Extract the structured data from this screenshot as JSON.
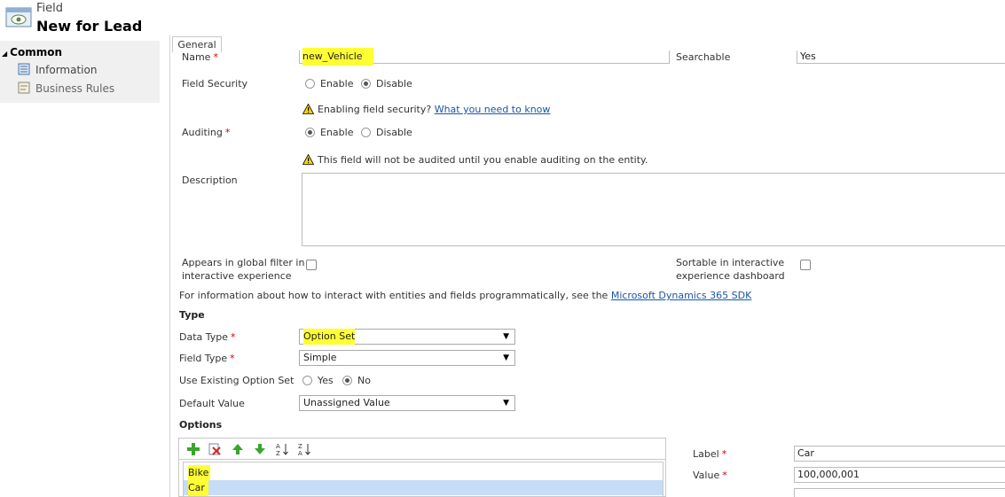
{
  "header": {
    "entity_label": "Field",
    "title": "New for Lead"
  },
  "sidebar": {
    "section": "Common",
    "items": [
      {
        "label": "Information",
        "icon": "information-icon"
      },
      {
        "label": "Business Rules",
        "icon": "business-rules-icon"
      }
    ]
  },
  "tabs": [
    {
      "label": "General"
    }
  ],
  "form": {
    "name": {
      "label": "Name",
      "value": "new_Vehicle"
    },
    "searchable": {
      "label": "Searchable",
      "value": "Yes"
    },
    "field_security": {
      "label": "Field Security",
      "options": [
        "Enable",
        "Disable"
      ],
      "selected": "Disable",
      "warning_text": "Enabling field security?",
      "warning_link": "What you need to know"
    },
    "auditing": {
      "label": "Auditing",
      "options": [
        "Enable",
        "Disable"
      ],
      "selected": "Enable",
      "warning_text": "This field will not be audited until you enable auditing on the entity."
    },
    "description": {
      "label": "Description",
      "value": ""
    },
    "global_filter": {
      "label_line1": "Appears in global filter in",
      "label_line2": "interactive experience",
      "checked": false
    },
    "sortable": {
      "label_line1": "Sortable in interactive",
      "label_line2": "experience dashboard",
      "checked": false
    },
    "sdk_info": {
      "text": "For information about how to interact with entities and fields programmatically, see the",
      "link": "Microsoft Dynamics 365 SDK"
    },
    "type_section": "Type",
    "data_type": {
      "label": "Data Type",
      "value": "Option Set"
    },
    "field_type": {
      "label": "Field Type",
      "value": "Simple"
    },
    "use_existing": {
      "label": "Use Existing Option Set",
      "options": [
        "Yes",
        "No"
      ],
      "selected": "No"
    },
    "default_value": {
      "label": "Default Value",
      "value": "Unassigned Value"
    },
    "options_section": "Options",
    "options_list": [
      {
        "label": "Bike",
        "selected": false
      },
      {
        "label": "Car",
        "selected": true
      }
    ],
    "option_label": {
      "label": "Label",
      "value": "Car"
    },
    "option_value": {
      "label": "Value",
      "value": "100,000,001"
    }
  },
  "colors": {
    "link": "#1a56a8",
    "highlight": "#ffff33",
    "selected_row": "#c7dcf7",
    "required": "#cc0000"
  }
}
